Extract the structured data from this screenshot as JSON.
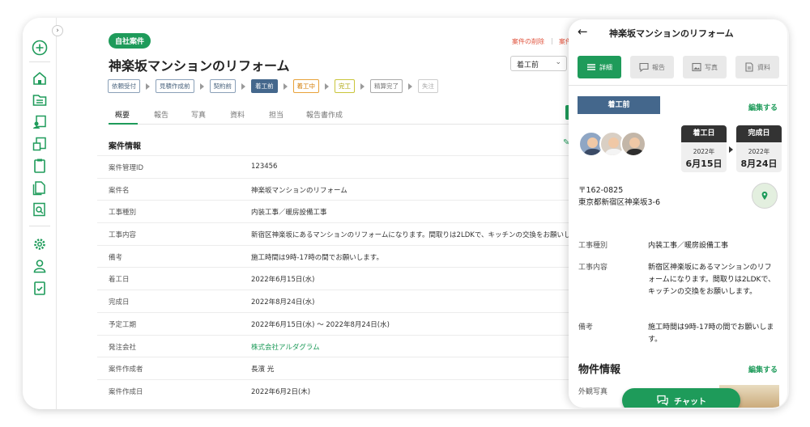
{
  "main": {
    "badge": "自社案件",
    "delete_link": "案件の削除",
    "separator": "|",
    "copy_link": "案件",
    "title": "神楽坂マンションのリフォーム",
    "status_select": "着工前",
    "steps": [
      "依頼受付",
      "見積作成前",
      "契約前",
      "着工前",
      "着工中",
      "完工",
      "精算完了",
      "失注"
    ],
    "tabs": [
      "概要",
      "報告",
      "写真",
      "資料",
      "担当",
      "報告書作成"
    ],
    "section_title": "案件情報",
    "rows": [
      {
        "label": "案件管理ID",
        "value": "123456"
      },
      {
        "label": "案件名",
        "value": "神楽坂マンションのリフォーム"
      },
      {
        "label": "工事種別",
        "value": "内装工事／暖房設備工事"
      },
      {
        "label": "工事内容",
        "value": "新宿区神楽坂にあるマンションのリフォームになります。間取りは2LDKで、キッチンの交換をお願いし"
      },
      {
        "label": "備考",
        "value": "施工時間は9時-17時の間でお願いします。"
      },
      {
        "label": "着工日",
        "value": "2022年6月15日(水)"
      },
      {
        "label": "完成日",
        "value": "2022年8月24日(水)"
      },
      {
        "label": "予定工期",
        "value": "2022年6月15日(水) 〜 2022年8月24日(水)"
      },
      {
        "label": "発注会社",
        "value": "株式会社アルダグラム"
      },
      {
        "label": "案件作成者",
        "value": "長濱 光"
      },
      {
        "label": "案件作成日",
        "value": "2022年6月2日(木)"
      }
    ]
  },
  "mobile": {
    "title": "神楽坂マンションのリフォーム",
    "tabs": [
      "詳細",
      "報告",
      "写真",
      "資料"
    ],
    "status": "着工前",
    "edit_label": "編集する",
    "start": {
      "label": "着工日",
      "year": "2022年",
      "date": "6月15日"
    },
    "end": {
      "label": "完成日",
      "year": "2022年",
      "date": "8月24日"
    },
    "postal": "〒162-0825",
    "address": "東京都新宿区神楽坂3-6",
    "rows": [
      {
        "label": "工事種別",
        "value": "内装工事／暖房設備工事"
      },
      {
        "label": "工事内容",
        "value": "新宿区神楽坂にあるマンションのリフォームになります。間取りは2LDKで、キッチンの交換をお願いします。"
      },
      {
        "label": "備考",
        "value": "施工時間は9時-17時の間でお願いします。"
      }
    ],
    "property_section": "物件情報",
    "property_edit": "編集する",
    "exterior_photo": "外観写真",
    "chat_label": "チャット"
  },
  "icons": {
    "accent": "#1e9b5a",
    "status_blue": "#44678c",
    "danger": "#e0533d",
    "rail": [
      "add-icon",
      "home-icon",
      "folder-icon",
      "user-document-icon",
      "document-icon",
      "clipboard-icon",
      "files-icon",
      "search-document-icon",
      "settings-icon",
      "user-icon",
      "checklist-icon"
    ]
  }
}
